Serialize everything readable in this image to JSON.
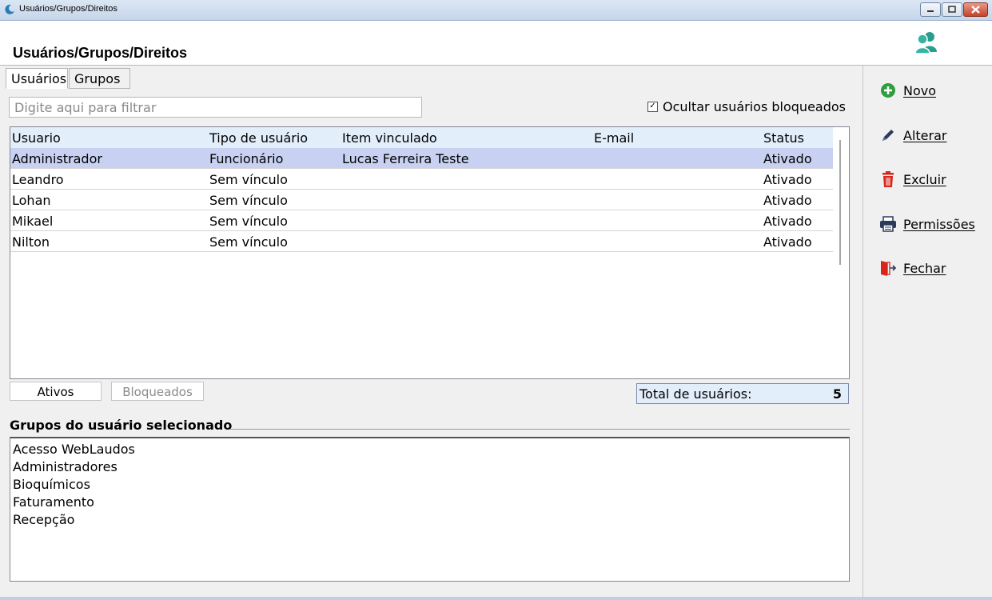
{
  "window": {
    "title": "Usuários/Grupos/Direitos",
    "app_icon": "app-crescent-icon",
    "controls": [
      "minimize-icon",
      "maximize-icon",
      "close-icon"
    ]
  },
  "header": {
    "title": "Usuários/Grupos/Direitos",
    "icon": "users-icon",
    "accent_color": "#2a9d8f"
  },
  "tabs": [
    {
      "label": "Usuários",
      "active": true
    },
    {
      "label": "Grupos",
      "active": false
    }
  ],
  "filter": {
    "placeholder": "Digite aqui para filtrar",
    "value": ""
  },
  "hide_blocked": {
    "label": "Ocultar usuários bloqueados",
    "checked": true
  },
  "table": {
    "columns": [
      "Usuario",
      "Tipo de usuário",
      "Item vinculado",
      "E-mail",
      "Status"
    ],
    "rows": [
      {
        "usuario": "Administrador",
        "tipo": "Funcionário",
        "item": "Lucas Ferreira Teste",
        "email": "",
        "status": "Ativado",
        "selected": true
      },
      {
        "usuario": "Leandro",
        "tipo": "Sem vínculo",
        "item": "",
        "email": "",
        "status": "Ativado",
        "selected": false
      },
      {
        "usuario": "Lohan",
        "tipo": "Sem vínculo",
        "item": "",
        "email": "",
        "status": "Ativado",
        "selected": false
      },
      {
        "usuario": "Mikael",
        "tipo": "Sem vínculo",
        "item": "",
        "email": "",
        "status": "Ativado",
        "selected": false
      },
      {
        "usuario": "Nilton",
        "tipo": "Sem vínculo",
        "item": "",
        "email": "",
        "status": "Ativado",
        "selected": false
      }
    ],
    "header_color": "#e3eefb",
    "selected_color": "#c8d1f1"
  },
  "status_filters": {
    "active_label": "Ativos",
    "blocked_label": "Bloqueados"
  },
  "total": {
    "label": "Total de usuários:",
    "value": "5"
  },
  "groups": {
    "title": "Grupos do usuário selecionado",
    "items": [
      "Acesso WebLaudos",
      "Administradores",
      "Bioquímicos",
      "Faturamento",
      "Recepção"
    ]
  },
  "actions": [
    {
      "label": "Novo",
      "icon": "plus-circle-icon",
      "color": "#2e9e3e"
    },
    {
      "label": "Alterar",
      "icon": "pencil-icon",
      "color": "#2a3a5a"
    },
    {
      "label": "Excluir",
      "icon": "trash-icon",
      "color": "#d9261c"
    },
    {
      "label": "Permissões",
      "icon": "printer-icon",
      "color": "#2a3a5a"
    },
    {
      "label": "Fechar",
      "icon": "exit-door-icon",
      "color": "#d9261c"
    }
  ]
}
